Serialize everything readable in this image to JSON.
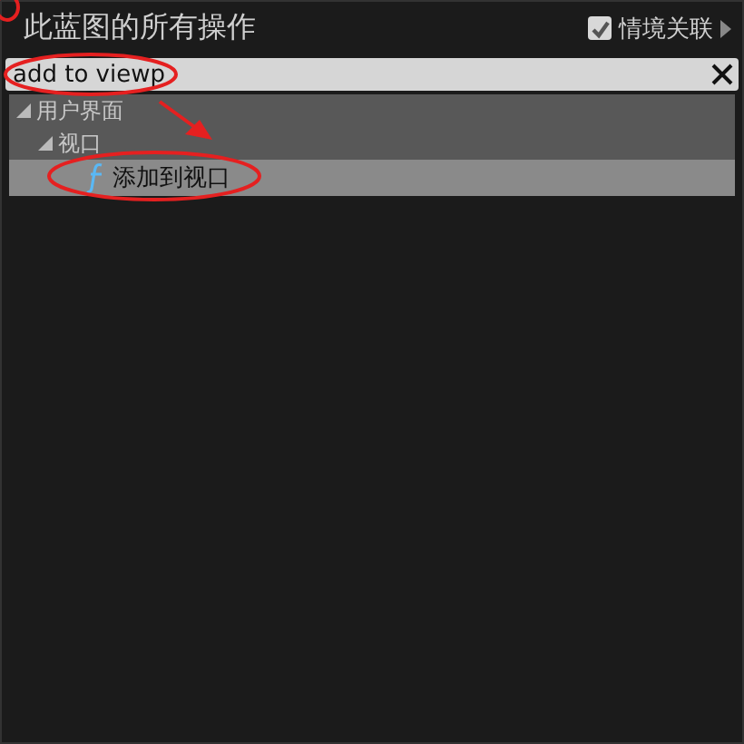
{
  "title": "此蓝图的所有操作",
  "context_toggle": {
    "label": "情境关联",
    "checked": true
  },
  "search": {
    "value": "add to viewp"
  },
  "tree": [
    {
      "label": "用户界面",
      "expanded": true,
      "selected": false,
      "children": [
        {
          "label": "视口",
          "expanded": true,
          "selected": false,
          "children": [
            {
              "label": "添加到视口",
              "kind": "function",
              "selected": true
            }
          ]
        }
      ]
    }
  ]
}
